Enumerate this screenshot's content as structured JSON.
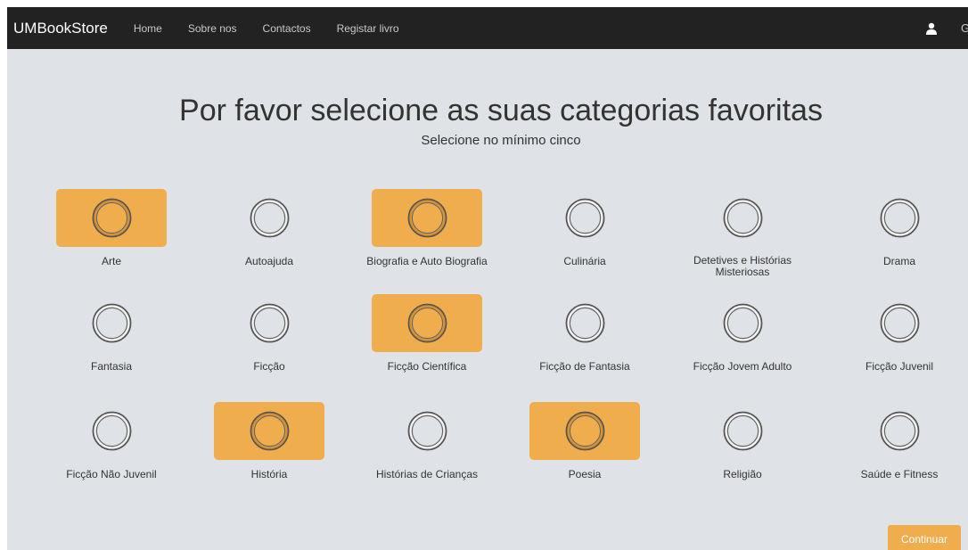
{
  "navbar": {
    "brand": "UMBookStore",
    "links": [
      "Home",
      "Sobre nos",
      "Contactos",
      "Registar livro"
    ],
    "user_icon": "user-icon",
    "cut_text": "G"
  },
  "heading": "Por favor selecione as suas categorias favoritas",
  "subheading": "Selecione no mínimo cinco",
  "colors": {
    "navbar_bg": "#222222",
    "page_bg": "#dfe2e6",
    "selected_accent": "#f0ad4e"
  },
  "categories": [
    {
      "label": "Arte",
      "selected": true
    },
    {
      "label": "Autoajuda",
      "selected": false
    },
    {
      "label": "Biografia e Auto Biografia",
      "selected": true
    },
    {
      "label": "Culinária",
      "selected": false
    },
    {
      "label": "Detetives e Histórias Misteriosas",
      "selected": false
    },
    {
      "label": "Drama",
      "selected": false
    },
    {
      "label": "Fantasia",
      "selected": false
    },
    {
      "label": "Ficção",
      "selected": false
    },
    {
      "label": "Ficção Científica",
      "selected": true
    },
    {
      "label": "Ficção de Fantasia",
      "selected": false
    },
    {
      "label": "Ficção Jovem Adulto",
      "selected": false
    },
    {
      "label": "Ficção Juvenil",
      "selected": false
    },
    {
      "label": "Ficção Não Juvenil",
      "selected": false
    },
    {
      "label": "História",
      "selected": true
    },
    {
      "label": "Histórias de Crianças",
      "selected": false
    },
    {
      "label": "Poesia",
      "selected": true
    },
    {
      "label": "Religião",
      "selected": false
    },
    {
      "label": "Saúde e Fitness",
      "selected": false
    }
  ],
  "continue_label": "Continuar"
}
